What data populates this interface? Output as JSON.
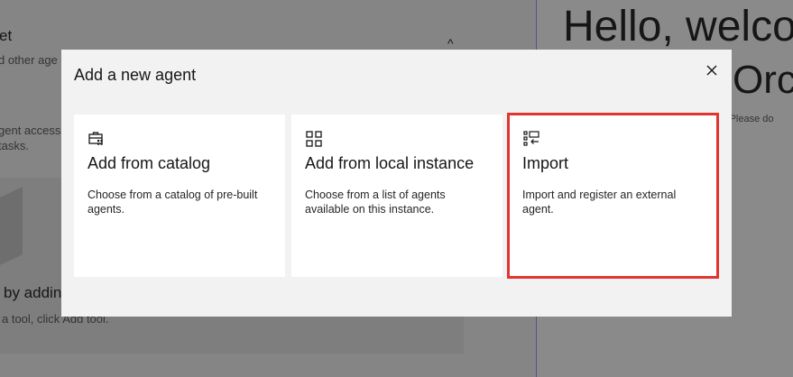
{
  "background": {
    "section_title": "et",
    "section_desc": "d other age",
    "collapse_glyph": "^",
    "access_line1": "gent access",
    "access_line2": "tasks.",
    "card_title": "by addin",
    "card_desc": "a tool, click Add tool.",
    "hero_line1": "Hello, welco",
    "hero_line2": "Orc",
    "hint_text": "ary. Please do"
  },
  "modal": {
    "title": "Add a new agent",
    "close_label": "×",
    "tiles": [
      {
        "icon": "catalog-icon",
        "title": "Add from catalog",
        "description": "Choose from a catalog of pre-built agents."
      },
      {
        "icon": "grid-icon",
        "title": "Add from local instance",
        "description": "Choose from a list of agents available on this instance."
      },
      {
        "icon": "import-icon",
        "title": "Import",
        "description": "Import and register an external agent."
      }
    ]
  },
  "colors": {
    "highlight": "#e3342f",
    "overlay": "#161616",
    "modal_bg": "#f2f2f2"
  }
}
